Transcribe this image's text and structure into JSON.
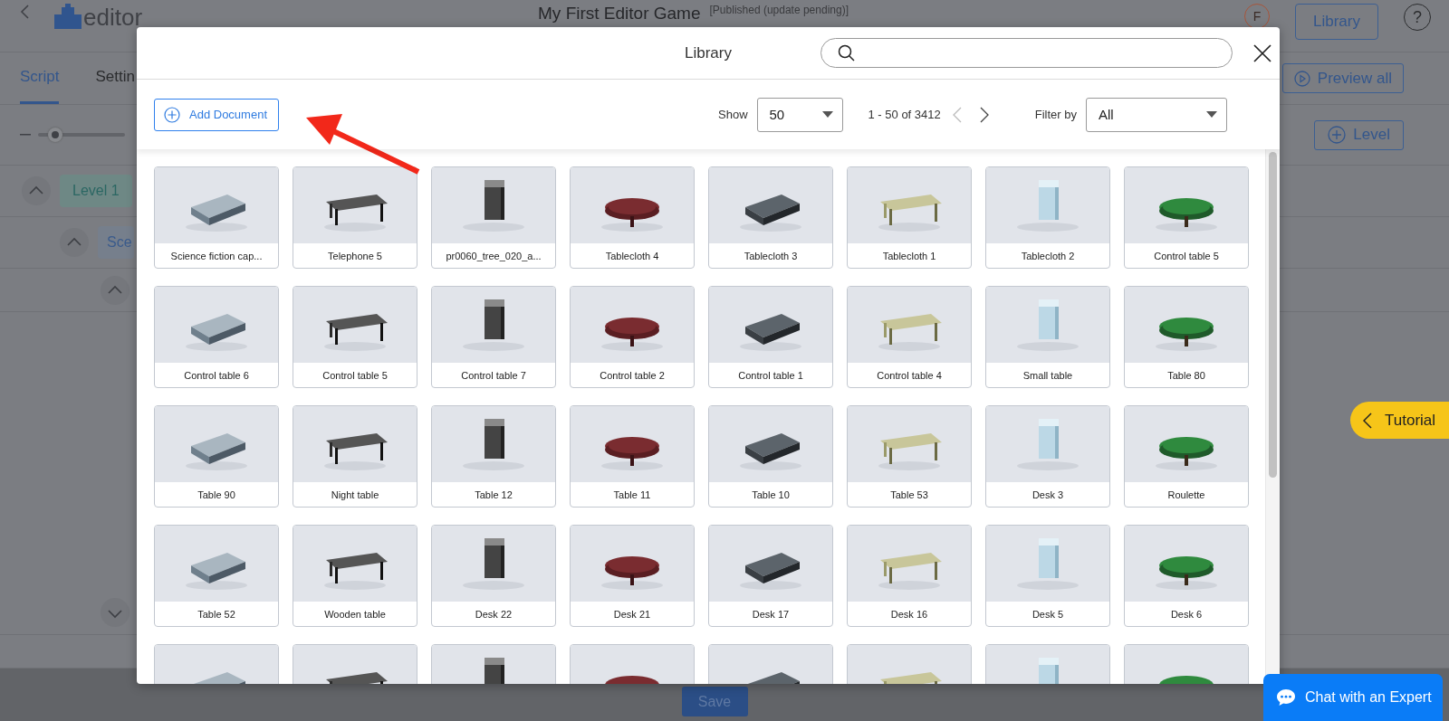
{
  "header": {
    "logo_text": "editor",
    "title": "My First Editor Game",
    "status": "[Published (update pending)]",
    "avatar": "F",
    "library_button": "Library",
    "help": "?"
  },
  "tabs": [
    {
      "label": "Script",
      "selected": true
    },
    {
      "label": "Settin",
      "selected": false
    }
  ],
  "preview_button": "Preview all",
  "zoom_slider": {
    "level": 0.2
  },
  "level_button": "Level",
  "tree": [
    {
      "label": "Level 1",
      "expanded": true,
      "children": [
        {
          "label": "Sce",
          "expanded": true
        }
      ]
    }
  ],
  "save_button": "Save",
  "tutorial_button": "Tutorial",
  "chat_button": "Chat with an Expert",
  "library": {
    "title": "Library",
    "add_button": "Add Document",
    "show_label": "Show",
    "page_size": "50",
    "range": "1 - 50 of 3412",
    "filter_label": "Filter by",
    "filter": "All",
    "cards": [
      {
        "kind": "asset",
        "label": "Science fiction cap..."
      },
      {
        "kind": "asset",
        "label": "Telephone 5"
      },
      {
        "kind": "asset",
        "label": "pr0060_tree_020_a..."
      },
      {
        "kind": "asset",
        "label": "Tablecloth 4"
      },
      {
        "kind": "asset",
        "label": "Tablecloth 3"
      },
      {
        "kind": "asset",
        "label": "Tablecloth 1"
      },
      {
        "kind": "asset",
        "label": "Tablecloth 2"
      },
      {
        "kind": "asset",
        "label": "Control table 5"
      },
      {
        "kind": "asset",
        "label": "Control table 6"
      },
      {
        "kind": "asset",
        "label": "Control table 5"
      },
      {
        "kind": "asset",
        "label": "Control table 7"
      },
      {
        "kind": "asset",
        "label": "Control table 2"
      },
      {
        "kind": "asset",
        "label": "Control table 1"
      },
      {
        "kind": "asset",
        "label": "Control table 4"
      },
      {
        "kind": "asset",
        "label": "Small table"
      },
      {
        "kind": "asset",
        "label": "Table 80"
      },
      {
        "kind": "asset",
        "label": "Table 90"
      },
      {
        "kind": "asset",
        "label": "Night table"
      },
      {
        "kind": "asset",
        "label": "Table 12"
      },
      {
        "kind": "asset",
        "label": "Table 11"
      },
      {
        "kind": "asset",
        "label": "Table 10"
      },
      {
        "kind": "asset",
        "label": "Table 53"
      },
      {
        "kind": "asset",
        "label": "Desk 3"
      },
      {
        "kind": "asset",
        "label": "Roulette"
      },
      {
        "kind": "asset",
        "label": "Table 52"
      },
      {
        "kind": "asset",
        "label": "Wooden table"
      },
      {
        "kind": "asset",
        "label": "Desk 22"
      },
      {
        "kind": "asset",
        "label": "Desk 21"
      },
      {
        "kind": "asset",
        "label": "Desk 17"
      },
      {
        "kind": "asset",
        "label": "Desk 16"
      },
      {
        "kind": "asset",
        "label": "Desk 5"
      },
      {
        "kind": "asset",
        "label": "Desk 6"
      },
      {
        "kind": "cut-off"
      },
      {
        "kind": "cut-off"
      },
      {
        "kind": "cut-off"
      },
      {
        "kind": "cut-off"
      },
      {
        "kind": "cut-off"
      },
      {
        "kind": "cut-off"
      },
      {
        "kind": "cut-off"
      },
      {
        "kind": "cut-off"
      }
    ]
  }
}
